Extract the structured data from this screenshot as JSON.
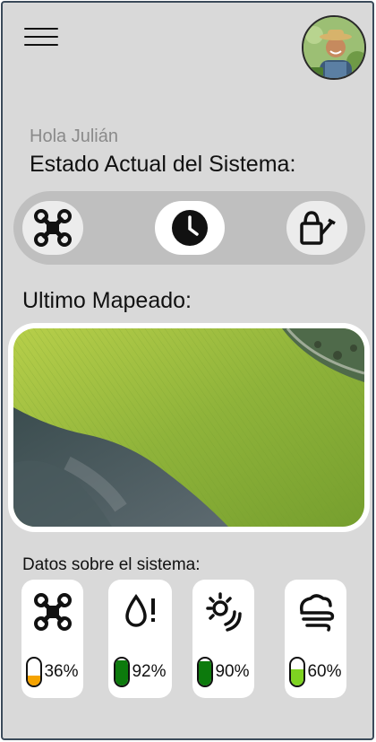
{
  "header": {
    "menu_icon": "hamburger-menu-icon",
    "avatar_icon": "farmer-avatar"
  },
  "greeting": "Hola Julián",
  "status": {
    "title": "Estado Actual del Sistema:",
    "buttons": [
      {
        "icon": "drone-icon",
        "active": false
      },
      {
        "icon": "clock-icon",
        "active": true
      },
      {
        "icon": "watering-can-icon",
        "active": false
      }
    ]
  },
  "map": {
    "title": "Ultimo Mapeado:"
  },
  "system_data": {
    "title": "Datos sobre el sistema:",
    "items": [
      {
        "icon": "drone-icon",
        "value": "36%",
        "level": 0.36,
        "color": "#f5a300"
      },
      {
        "icon": "water-alert-icon",
        "value": "92%",
        "level": 0.92,
        "color": "#0c7a0c"
      },
      {
        "icon": "sun-wind-icon",
        "value": "90%",
        "level": 0.9,
        "color": "#0c7a0c"
      },
      {
        "icon": "wind-cloud-icon",
        "value": "60%",
        "level": 0.6,
        "color": "#7ed321"
      }
    ]
  }
}
